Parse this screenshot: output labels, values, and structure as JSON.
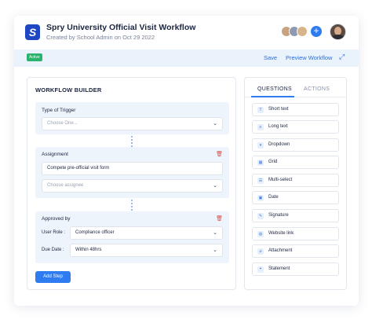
{
  "header": {
    "logo_letter": "S",
    "title": "Spry University Official Visit Workflow",
    "subtitle": "Created by School Admin on Oct 29 2022",
    "avatar_colors": [
      "#c9a27e",
      "#8e9ab0",
      "#d8b48a"
    ],
    "add_icon": "+"
  },
  "toolbar": {
    "status_badge": "Active",
    "save_label": "Save",
    "preview_label": "Preview Workflow",
    "expand_icon": "⤢"
  },
  "builder": {
    "title": "WORKFLOW BUILDER",
    "trigger": {
      "label": "Type of Trigger",
      "select_placeholder": "Choose One..."
    },
    "assignment": {
      "label": "Assignment",
      "task_value": "Compete pre-official visit form",
      "assignee_placeholder": "Choose assignee"
    },
    "approval": {
      "label": "Approved by",
      "user_role_label": "User Role :",
      "user_role_value": "Compliance officer",
      "due_date_label": "Due Date :",
      "due_date_value": "Within 48hrs"
    },
    "add_step_label": "Add Step"
  },
  "questions_panel": {
    "tabs": [
      "QUESTIONS",
      "ACTIONS"
    ],
    "active_tab": "QUESTIONS",
    "items": [
      {
        "label": "Short text",
        "icon": "T"
      },
      {
        "label": "Long text",
        "icon": "≡"
      },
      {
        "label": "Dropdown",
        "icon": "▾"
      },
      {
        "label": "Grid",
        "icon": "▦"
      },
      {
        "label": "Multi-select",
        "icon": "☰"
      },
      {
        "label": "Date",
        "icon": "▣"
      },
      {
        "label": "Signature",
        "icon": "✎"
      },
      {
        "label": "Website link",
        "icon": "◍"
      },
      {
        "label": "Attachment",
        "icon": "⌀"
      },
      {
        "label": "Statement",
        "icon": "❝"
      }
    ]
  }
}
